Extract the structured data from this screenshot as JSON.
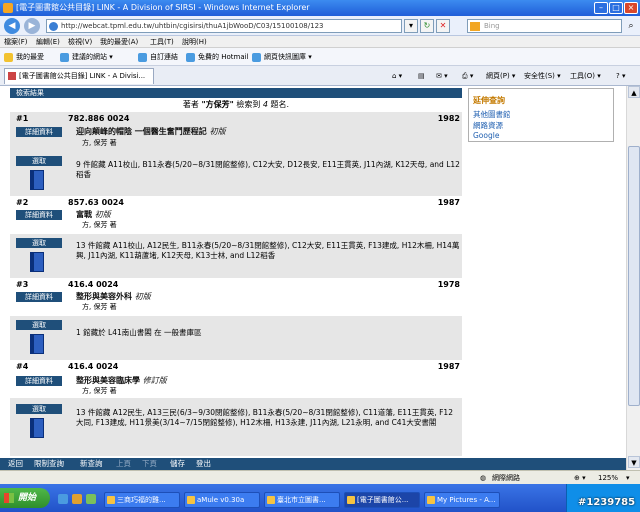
{
  "window": {
    "title": "[電子圖書館公共目錄] LINK - A Division of SIRSI - Windows Internet Explorer"
  },
  "address": {
    "url": "http://webcat.tpml.edu.tw/uhtbin/cgisirsi/thuA1jbWooD/C03/15100108/123",
    "search_placeholder": "Bing"
  },
  "menu": [
    "檔案(F)",
    "編輯(E)",
    "檢視(V)",
    "我的最愛(A)",
    "工具(T)",
    "說明(H)"
  ],
  "favorites": {
    "fav_label": "我的最愛",
    "items": [
      "建議的網站 ▾",
      "自訂連結",
      "免費的 Hotmail",
      "網頁快訊圖庫 ▾"
    ]
  },
  "tab": {
    "label": "[電子圖書館公共目錄] LINK - A Divisi..."
  },
  "commands": [
    "網頁(P) ▾",
    "安全性(S) ▾",
    "工具(O) ▾"
  ],
  "page": {
    "results_header": "檢索結果",
    "summary_pre": "著者 ",
    "summary_author": "\"方保芳\"",
    "summary_mid": " 檢索到 ",
    "summary_count": "4",
    "summary_post": " 題名.",
    "detail_label": "詳細資料",
    "select_label": "選取"
  },
  "records": [
    {
      "num": "#1",
      "call": "782.886 0024",
      "year": "1982",
      "title": "迎向顛峰的帽陰 一個醫生奮鬥歷程記",
      "edition": "初版",
      "author": "方, 保芳 著",
      "holdings": "9 件館藏 A11校山, B11永春(5/20~8/31閉館整修), C12大安, D12長安, E11王貫英, J11內湖, K12天母, and L12稻香"
    },
    {
      "num": "#2",
      "call": "857.63 0024",
      "year": "1987",
      "title": "富戰",
      "edition": "初版",
      "author": "方, 保芳 著",
      "holdings": "13 件館藏 A11校山, A12民生, B11永春(5/20~8/31閉館整修), C12大安, E11王貫英, F13建成, H12木柵, H14萬興, J11內湖, K11葫蘆堵, K12天母, K13士林, and L12稻香"
    },
    {
      "num": "#3",
      "call": "416.4 0024",
      "year": "1978",
      "title": "整形與美容外科",
      "edition": "初版",
      "author": "方, 保芳 著",
      "holdings": "1 館藏於 L41南山書閣 在 一般書庫區"
    },
    {
      "num": "#4",
      "call": "416.4 0024",
      "year": "1987",
      "title": "整形與美容臨床學",
      "edition": "修訂版",
      "author": "方, 保芳 著",
      "holdings": "13 件館藏 A12民生, A13三民(6/3~9/30閉館整修), B11永春(5/20~8/31閉館整修), C11道藩, E11王貫英, F12大同, F13建成, H11景美(3/14~7/15閉館整修), H12木柵, H13永建, J11內湖, L21永明, and C41大安書閣"
    }
  ],
  "sidebar": {
    "title": "延伸查詢",
    "links": [
      "其他圖書館",
      "網路資源",
      "Google"
    ]
  },
  "bottom_nav": {
    "active": [
      "返回",
      "限制查詢",
      "新查詢"
    ],
    "disabled": [
      "上頁",
      "下頁"
    ],
    "tail": [
      "儲存",
      "登出"
    ]
  },
  "status": {
    "zone": "網際網路",
    "zoom": "125%"
  },
  "taskbar": {
    "start": "開始",
    "tasks": [
      "三商巧福的雞...",
      "aMule v0.30a",
      "臺北市立圖書...",
      "[電子圖書館公...",
      "My Pictures - A..."
    ],
    "clock": "#1239785"
  },
  "colors": {
    "nav_blue": "#1f4f7a",
    "band_gray": "#e6e6e6",
    "sidebar_title": "#c47a00",
    "link_blue": "#1f5fb0"
  }
}
